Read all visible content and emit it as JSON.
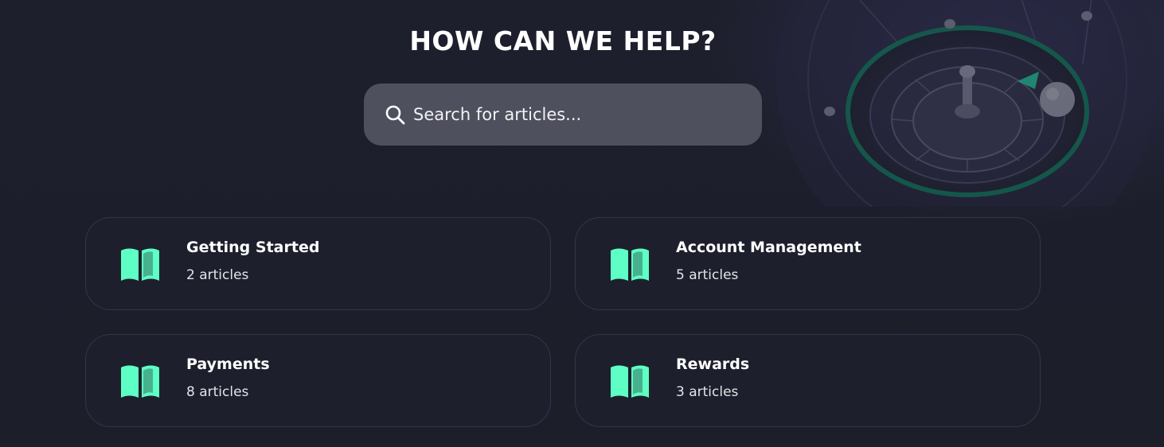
{
  "hero": {
    "title": "HOW CAN WE HELP?"
  },
  "search": {
    "placeholder": "Search for articles...",
    "icon": "search-icon"
  },
  "colors": {
    "background": "#1c1e2b",
    "accent": "#5effc4",
    "search_bg": "#4f505d",
    "card_border": "#33364a"
  },
  "categories": [
    {
      "title": "Getting Started",
      "count": "2 articles",
      "icon": "book-icon"
    },
    {
      "title": "Account Management",
      "count": "5 articles",
      "icon": "book-icon"
    },
    {
      "title": "Payments",
      "count": "8 articles",
      "icon": "book-icon"
    },
    {
      "title": "Rewards",
      "count": "3 articles",
      "icon": "book-icon"
    }
  ]
}
